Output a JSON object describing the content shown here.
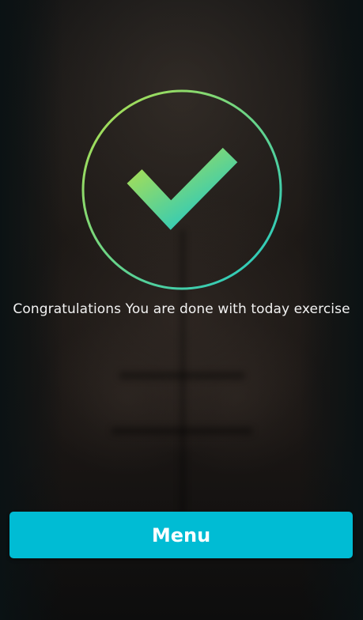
{
  "completion": {
    "icon": "checkmark-icon",
    "message": "Congratulations You are done with today exercise"
  },
  "actions": {
    "menu_label": "Menu"
  },
  "colors": {
    "accent": "#00bcd4",
    "check_gradient_start": "#b4e04a",
    "check_gradient_end": "#1ec8c8",
    "text": "#f2f2f2"
  }
}
